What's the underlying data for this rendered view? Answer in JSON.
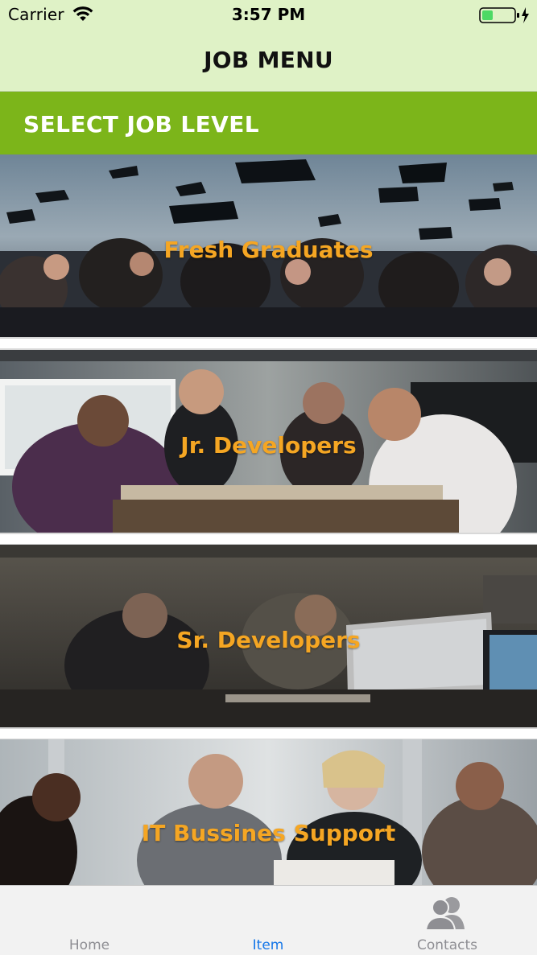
{
  "status_bar": {
    "carrier": "Carrier",
    "time": "3:57 PM",
    "wifi_icon": "wifi-icon",
    "battery_icon": "battery-charging-icon",
    "battery_color": "#4cd964"
  },
  "nav": {
    "title": "JOB MENU"
  },
  "section": {
    "title": "SELECT JOB LEVEL",
    "background_color": "#7cb51a"
  },
  "job_levels": [
    {
      "label": "Fresh Graduates"
    },
    {
      "label": "Jr. Developers"
    },
    {
      "label": "Sr. Developers"
    },
    {
      "label": "IT Bussines Support"
    }
  ],
  "label_color": "#f5a623",
  "tab_bar": {
    "tabs": [
      {
        "label": "Home",
        "selected": false
      },
      {
        "label": "Item",
        "selected": true
      },
      {
        "label": "Contacts",
        "selected": false,
        "icon": "contacts-icon"
      }
    ],
    "selected_color": "#1677e8",
    "unselected_color": "#8e8e93"
  }
}
